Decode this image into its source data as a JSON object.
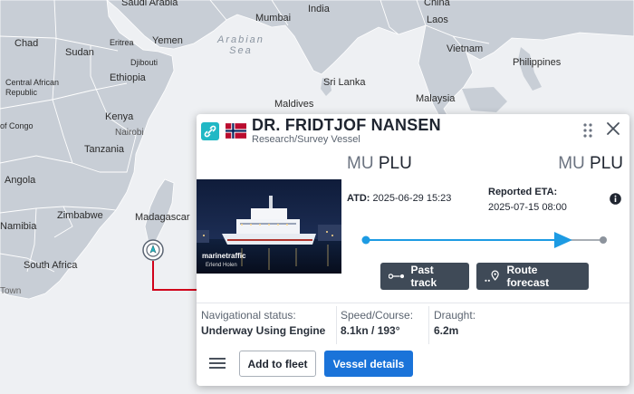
{
  "map": {
    "labels": {
      "saudi_arabia": "Saudi Arabia",
      "india": "India",
      "china": "China",
      "mumbai": "Mumbai",
      "laos": "Laos",
      "chad": "Chad",
      "sudan": "Sudan",
      "eritrea": "Eritrea",
      "yemen": "Yemen",
      "arabian_sea": "Arabian\nSea",
      "vietnam": "Vietnam",
      "djibouti": "Djibouti",
      "philippines": "Philippines",
      "car": "Central African\nRepublic",
      "ethiopia": "Ethiopia",
      "sri_lanka": "Sri Lanka",
      "maldives": "Maldives",
      "malaysia": "Malaysia",
      "congo": "of Congo",
      "kenya": "Kenya",
      "nairobi": "Nairobi",
      "tanzania": "Tanzania",
      "angola": "Angola",
      "zimbabwe": "Zimbabwe",
      "madagascar": "Madagascar",
      "namibia": "Namibia",
      "south_africa": "South Africa",
      "town": "Town"
    }
  },
  "vessel": {
    "name": "DR. FRIDTJOF NANSEN",
    "type": "Research/Survey Vessel",
    "flag_icon": "norway-flag-icon",
    "photo_watermark": "marinetraffic",
    "photo_credit": "Erlend Holen",
    "from_port": {
      "country": "MU",
      "code": "PLU"
    },
    "to_port": {
      "country": "MU",
      "code": "PLU"
    },
    "atd_label": "ATD:",
    "atd_value": "2025-06-29 15:23",
    "eta_label": "Reported ETA:",
    "eta_value": "2025-07-15 08:00",
    "past_track_label": "Past track",
    "route_forecast_label": "Route forecast",
    "nav_status_label": "Navigational status:",
    "nav_status_value": "Underway Using Engine",
    "speed_course_label": "Speed/Course:",
    "speed_course_value": "8.1kn / 193°",
    "draught_label": "Draught:",
    "draught_value": "6.2m",
    "add_to_fleet_label": "Add to fleet",
    "vessel_details_label": "Vessel details",
    "route_progress": 0.87
  },
  "colors": {
    "route_blue": "#1d9be3",
    "primary_button": "#1a73d9",
    "dark_button": "#3f4a57",
    "marker_red": "#d0021b",
    "link_icon_bg": "#21b8c5"
  }
}
